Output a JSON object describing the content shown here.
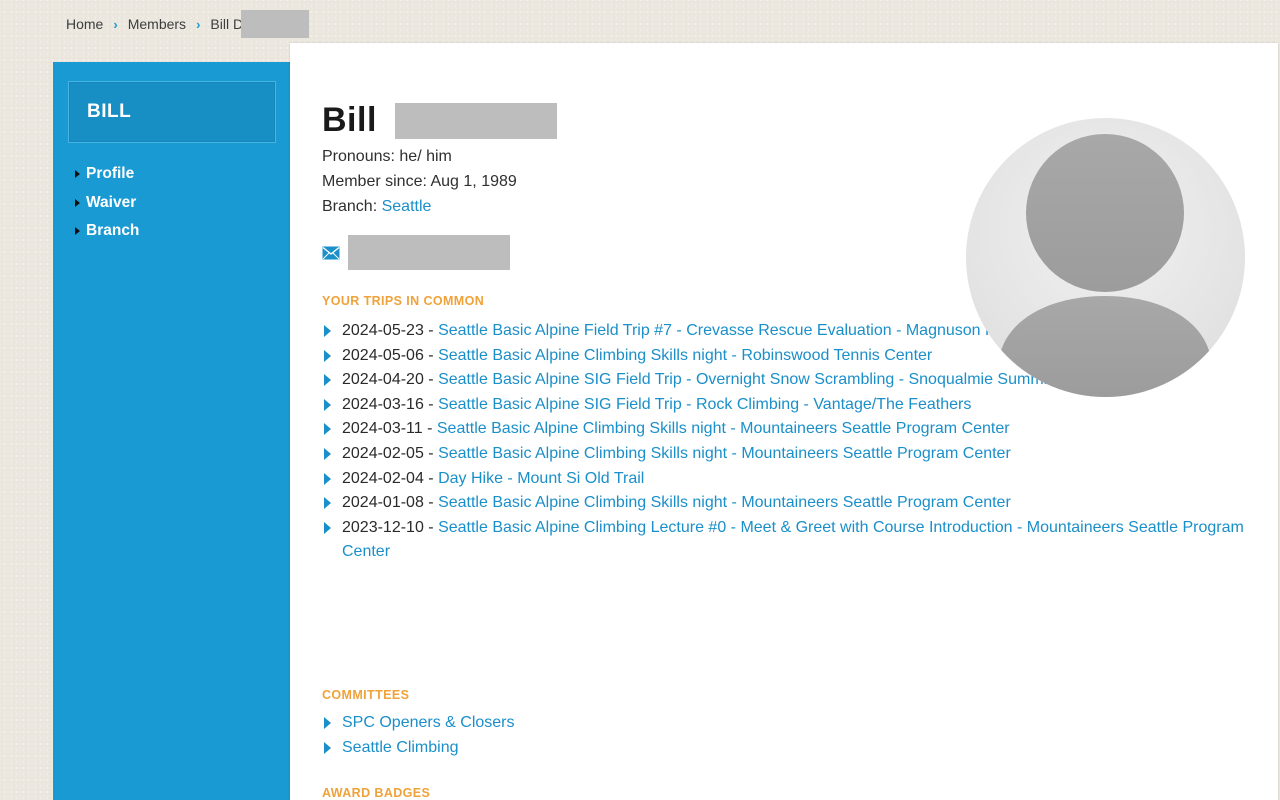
{
  "breadcrumb": {
    "home": "Home",
    "members": "Members",
    "current": "Bill D"
  },
  "sidebar": {
    "title": "BILL",
    "items": [
      {
        "label": "Profile"
      },
      {
        "label": "Waiver"
      },
      {
        "label": "Branch"
      }
    ]
  },
  "profile": {
    "first_name": "Bill",
    "pronouns_label": "Pronouns:",
    "pronouns_value": "he/ him",
    "member_since_label": "Member since:",
    "member_since_value": "Aug 1, 1989",
    "branch_label": "Branch:",
    "branch_value": "Seattle"
  },
  "trips": {
    "heading": "YOUR TRIPS IN COMMON",
    "items": [
      {
        "date": "2024-05-23",
        "title": "Seattle Basic Alpine Field Trip #7 - Crevasse Rescue Evaluation - Magnuson Park"
      },
      {
        "date": "2024-05-06",
        "title": "Seattle Basic Alpine Climbing Skills night - Robinswood Tennis Center"
      },
      {
        "date": "2024-04-20",
        "title": "Seattle Basic Alpine SIG Field Trip - Overnight Snow Scrambling - Snoqualmie Summit West"
      },
      {
        "date": "2024-03-16",
        "title": "Seattle Basic Alpine SIG Field Trip - Rock Climbing - Vantage/The Feathers"
      },
      {
        "date": "2024-03-11",
        "title": "Seattle Basic Alpine Climbing Skills night - Mountaineers Seattle Program Center"
      },
      {
        "date": "2024-02-05",
        "title": "Seattle Basic Alpine Climbing Skills night - Mountaineers Seattle Program Center"
      },
      {
        "date": "2024-02-04",
        "title": "Day Hike - Mount Si Old Trail"
      },
      {
        "date": "2024-01-08",
        "title": "Seattle Basic Alpine Climbing Skills night - Mountaineers Seattle Program Center"
      },
      {
        "date": "2023-12-10",
        "title": "Seattle Basic Alpine Climbing Lecture #0 - Meet & Greet with Course Introduction - Mountaineers Seattle Program Center"
      }
    ]
  },
  "committees": {
    "heading": "COMMITTEES",
    "items": [
      {
        "label": "SPC Openers & Closers"
      },
      {
        "label": "Seattle Climbing"
      }
    ]
  },
  "badges": {
    "heading": "AWARD BADGES"
  },
  "colors": {
    "sidebar": "#1a9ad3",
    "link": "#1a8fc9",
    "section_heading": "#f0a23a",
    "redaction": "#bdbdbd"
  },
  "icons": [
    "chevron-right-icon",
    "caret-right-icon",
    "mail-icon",
    "avatar-placeholder-icon"
  ]
}
